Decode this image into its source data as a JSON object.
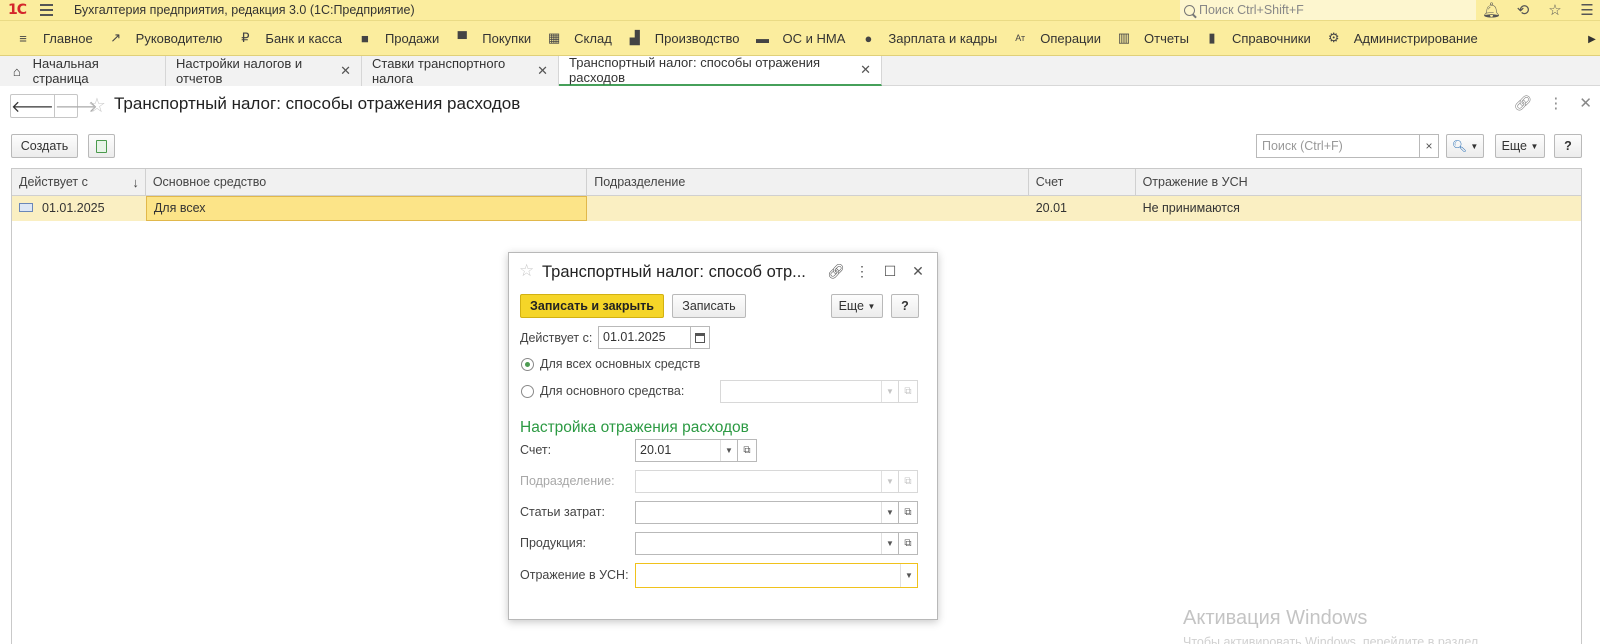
{
  "app": {
    "title": "Бухгалтерия предприятия, редакция 3.0  (1С:Предприятие)",
    "search_placeholder": "Поиск Ctrl+Shift+F",
    "logo": "1С"
  },
  "sections": [
    {
      "label": "Главное",
      "icon": "menu-icon"
    },
    {
      "label": "Руководителю",
      "icon": "trend-icon"
    },
    {
      "label": "Банк и касса",
      "icon": "ruble-icon"
    },
    {
      "label": "Продажи",
      "icon": "bag-icon"
    },
    {
      "label": "Покупки",
      "icon": "cart-icon"
    },
    {
      "label": "Склад",
      "icon": "warehouse-icon"
    },
    {
      "label": "Производство",
      "icon": "factory-icon"
    },
    {
      "label": "ОС и НМА",
      "icon": "truck-icon"
    },
    {
      "label": "Зарплата и кадры",
      "icon": "person-icon"
    },
    {
      "label": "Операции",
      "icon": "operations-icon"
    },
    {
      "label": "Отчеты",
      "icon": "bar-chart-icon"
    },
    {
      "label": "Справочники",
      "icon": "books-icon"
    },
    {
      "label": "Администрирование",
      "icon": "gear-icon"
    }
  ],
  "tabs": [
    {
      "label": "Начальная страница"
    },
    {
      "label": "Настройки налогов и отчетов"
    },
    {
      "label": "Ставки транспортного налога"
    },
    {
      "label": "Транспортный налог: способы отражения расходов"
    }
  ],
  "form": {
    "title": "Транспортный налог: способы отражения расходов",
    "create_label": "Создать",
    "search_placeholder": "Поиск (Ctrl+F)",
    "clear_label": "×",
    "more_label": "Еще",
    "help_label": "?"
  },
  "table": {
    "columns": [
      "Действует с",
      "Основное средство",
      "Подразделение",
      "Счет",
      "Отражение в УСН"
    ],
    "rows": [
      {
        "date": "01.01.2025",
        "asset": "Для всех",
        "department": "",
        "account": "20.01",
        "usn": "Не принимаются"
      }
    ]
  },
  "dialog": {
    "title": "Транспортный налог: способ отр...",
    "save_close_label": "Записать и закрыть",
    "save_label": "Записать",
    "more_label": "Еще",
    "help_label": "?",
    "valid_from_label": "Действует с:",
    "valid_from_value": "01.01.2025",
    "radio_all_label": "Для всех основных средств",
    "radio_all_selected": true,
    "radio_one_label": "Для основного средства:",
    "radio_one_value": "",
    "section_title": "Настройка отражения расходов",
    "account_label": "Счет:",
    "account_value": "20.01",
    "department_label": "Подразделение:",
    "department_value": "",
    "cost_items_label": "Статьи затрат:",
    "cost_items_value": "",
    "products_label": "Продукция:",
    "products_value": "",
    "usn_label": "Отражение в УСН:",
    "usn_value": ""
  },
  "watermark": {
    "title": "Активация Windows",
    "subtitle": "Чтобы активировать Windows, перейдите в раздел"
  },
  "colors": {
    "topbar": "#fbed9e",
    "accent_green": "#2c9a43",
    "primary_button": "#f5d528",
    "selected_row": "#faefc2"
  }
}
